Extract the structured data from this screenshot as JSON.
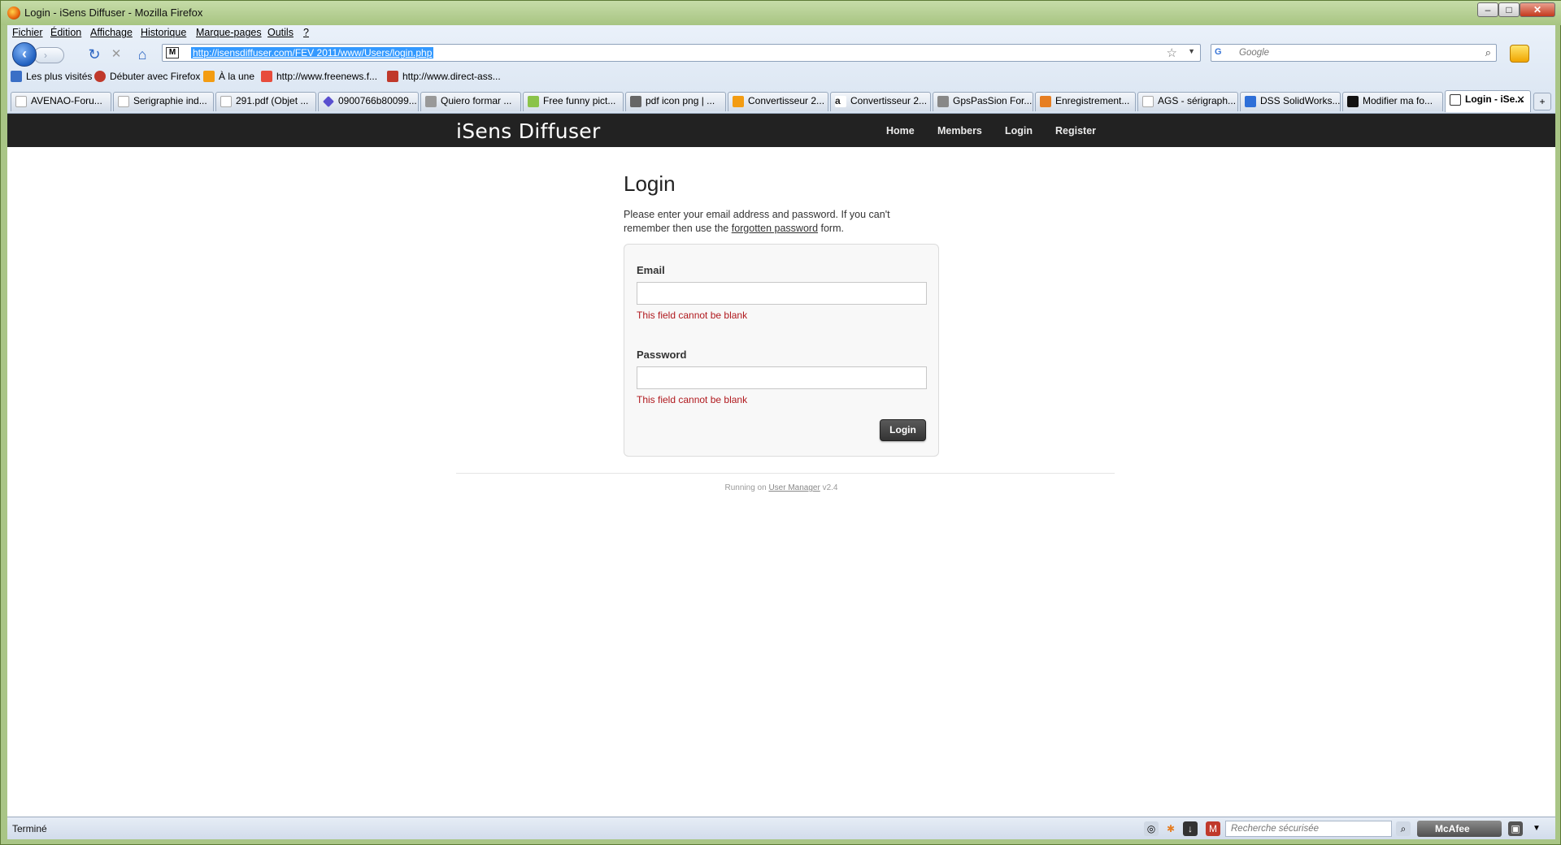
{
  "window": {
    "title": "Login - iSens Diffuser - Mozilla Firefox",
    "min": "–",
    "max": "□",
    "close": "✕"
  },
  "menubar": [
    "Fichier",
    "Édition",
    "Affichage",
    "Historique",
    "Marque-pages",
    "Outils",
    "?"
  ],
  "navbar": {
    "back": "‹",
    "forward": "›",
    "reload": "↻",
    "stop": "✕",
    "home": "⌂",
    "url": "http://isensdiffuser.com/FEV 2011/www/Users/login.php",
    "site_icon": "M",
    "search_engine": "G",
    "search_placeholder": "Google"
  },
  "bookmarks": [
    {
      "label": "Les plus visités",
      "color": "#3a6fc6"
    },
    {
      "label": "Débuter avec Firefox",
      "color": "#c0392b"
    },
    {
      "label": "À la une",
      "color": "#f39c12"
    },
    {
      "label": "http://www.freenews.f...",
      "color": "#e74c3c"
    },
    {
      "label": "http://www.direct-ass...",
      "color": "#c0392b"
    }
  ],
  "tabs": [
    {
      "label": "AVENAO-Foru...",
      "color": "#ffffff"
    },
    {
      "label": "Serigraphie ind...",
      "color": "#ffffff"
    },
    {
      "label": "291.pdf (Objet ...",
      "color": "#ffffff"
    },
    {
      "label": "0900766b80099...",
      "color": "#5a4fcf"
    },
    {
      "label": "Quiero formar ...",
      "color": "#999999"
    },
    {
      "label": "Free funny pict...",
      "color": "#8bc34a"
    },
    {
      "label": "pdf icon png | ...",
      "color": "#666666"
    },
    {
      "label": "Convertisseur 2...",
      "color": "#f39c12"
    },
    {
      "label": "Convertisseur 2...",
      "color": "#222222"
    },
    {
      "label": "GpsPasSion For...",
      "color": "#888888"
    },
    {
      "label": "Enregistrement...",
      "color": "#e67e22"
    },
    {
      "label": "AGS - sérigraph...",
      "color": "#ffffff"
    },
    {
      "label": "DSS SolidWorks...",
      "color": "#2e6fd8"
    },
    {
      "label": "Modifier ma fo...",
      "color": "#111111"
    },
    {
      "label": "Login - iSe...",
      "color": "#333333",
      "active": true
    }
  ],
  "site": {
    "brand": "iSens Diffuser",
    "nav": [
      "Home",
      "Members",
      "Login",
      "Register"
    ],
    "heading": "Login",
    "intro_before": "Please enter your email address and password. If you can't remember then use the ",
    "intro_link": "forgotten password",
    "intro_after": " form.",
    "email_label": "Email",
    "email_value": "",
    "email_error": "This field cannot be blank",
    "password_label": "Password",
    "password_value": "",
    "password_error": "This field cannot be blank",
    "login_button": "Login",
    "footer_before": "Running on ",
    "footer_link": "User Manager",
    "footer_after": " v2.4"
  },
  "statusbar": {
    "text": "Terminé",
    "secure_search_placeholder": "Recherche sécurisée",
    "mcafee": "McAfee"
  },
  "colors": {
    "site_nav_bg": "#222222",
    "error": "#b0191e",
    "url_highlight": "#3399ff"
  }
}
